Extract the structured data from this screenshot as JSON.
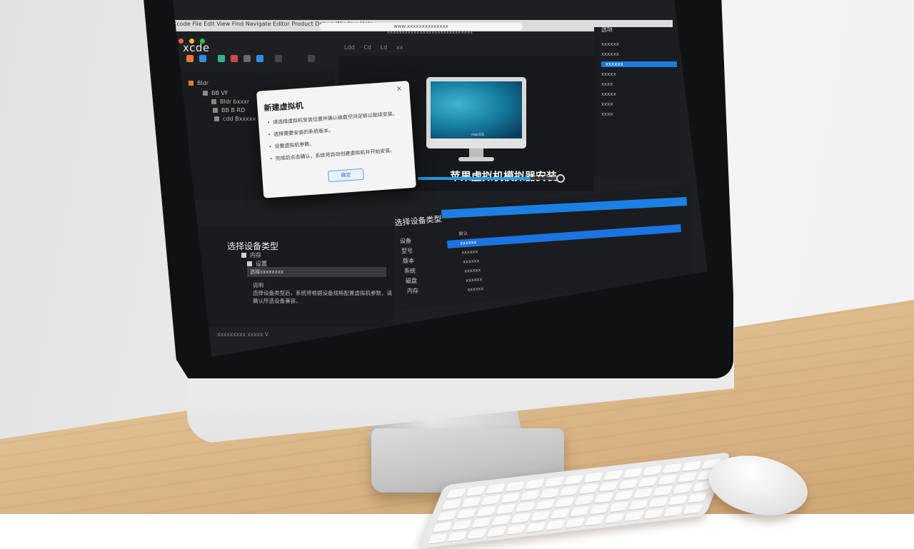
{
  "colors": {
    "accent": "#1b7fe3",
    "window_bg": "#1e1f22",
    "dialog_bg": "#f4f4f4",
    "traffic_red": "#ff5f57",
    "traffic_yellow": "#febc2e",
    "traffic_green": "#28c840"
  },
  "app": {
    "brand": "xcde",
    "menubar_text": "Xcode   File   Edit   View   Find   Navigate   Editor   Product   Debug   Window   Help",
    "title_url": "www.xxxxxxxxxxxxxx",
    "titlebar_text": "xxxxxxxxxxxxxxxxxxxxxxxxxxxxx",
    "tabs": [
      "Ldd",
      "Cd",
      "Ld",
      "xx"
    ]
  },
  "navigator": {
    "items": [
      {
        "label": "Bldr",
        "icon": "folder-icon"
      },
      {
        "label": "BB VF",
        "icon": "folder-icon"
      },
      {
        "label": "Bldr bxxxr",
        "icon": "file-icon"
      },
      {
        "label": "BB B RD",
        "icon": "file-icon"
      },
      {
        "label": "cdd Bxxxxx",
        "icon": "file-icon"
      }
    ]
  },
  "canvas": {
    "title": "苹果虚拟机模拟器安装",
    "progress": 0.8,
    "mac_caption": "macOS"
  },
  "dialog": {
    "title": "新建虚拟机",
    "close": "×",
    "bullets": [
      "请选择虚拟机安装位置并确认磁盘空间足够以继续安装。",
      "选择需要安装的系统版本。",
      "设置虚拟机参数。",
      "完成后点击确认，系统将自动创建虚拟机并开始安装。"
    ],
    "confirm": "确定"
  },
  "inspector": {
    "title": "选项",
    "items": [
      {
        "label": "xxxxxx",
        "selected": false
      },
      {
        "label": "xxxxxx",
        "selected": false
      },
      {
        "label": "xxxxxx",
        "selected": true
      },
      {
        "label": "xxxxx",
        "selected": false
      },
      {
        "label": "xxxx",
        "selected": false
      },
      {
        "label": "xxxxx",
        "selected": false
      },
      {
        "label": "xxxx",
        "selected": false
      },
      {
        "label": "xxxx",
        "selected": false
      }
    ]
  },
  "lower_left": {
    "section_title": "选择设备类型",
    "item1": "内存",
    "item2": "设置",
    "select_value": "选择xxxxxxxx",
    "desc_title": "说明",
    "desc_text": "选择设备类型后，系统将根据设备规格配置虚拟机参数，请确认所选设备兼容。",
    "footer": "xxxxxxxxx  xxxxx   V"
  },
  "lower_right": {
    "title": "选择设备类型",
    "labels": [
      "设备",
      "型号",
      "版本",
      "系统",
      "磁盘",
      "内存"
    ],
    "rows": [
      {
        "label": "默认",
        "selected": false
      },
      {
        "label": "xxxxxx",
        "selected": true
      },
      {
        "label": "xxxxxx",
        "selected": false
      },
      {
        "label": "xxxxxx",
        "selected": false
      },
      {
        "label": "xxxxxx",
        "selected": false
      },
      {
        "label": "xxxxxx",
        "selected": false
      },
      {
        "label": "xxxxxx",
        "selected": false
      }
    ]
  }
}
